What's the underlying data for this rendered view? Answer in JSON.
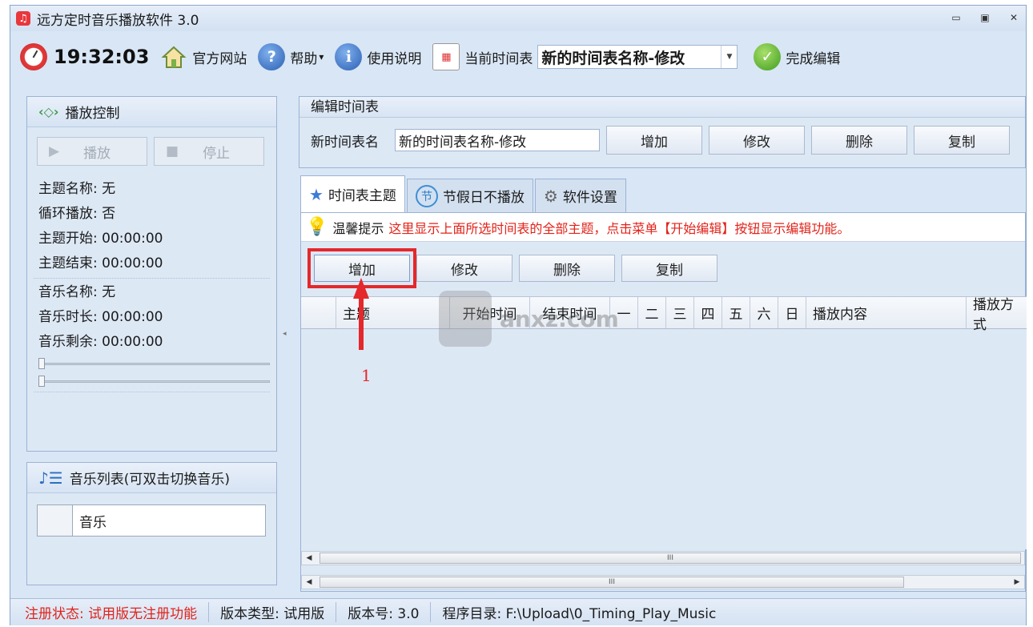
{
  "window": {
    "title": "远方定时音乐播放软件 3.0",
    "minimize": "▭",
    "restore": "▣",
    "close": "✕"
  },
  "toolbar": {
    "time": "19:32:03",
    "website": "官方网站",
    "help": "帮助",
    "help_arrow": "▾",
    "manual": "使用说明",
    "current_schedule_label": "当前时间表",
    "current_schedule_value": "新的时间表名称-修改",
    "finish_edit": "完成编辑"
  },
  "play_panel": {
    "title": "播放控制",
    "play": "播放",
    "stop": "停止",
    "theme_name": "主题名称: 无",
    "loop": "循环播放: 否",
    "theme_start": "主题开始: 00:00:00",
    "theme_end": "主题结束: 00:00:00",
    "music_name": "音乐名称: 无",
    "music_duration": "音乐时长: 00:00:00",
    "music_remaining": "音乐剩余: 00:00:00",
    "progress": 0,
    "volume": 0
  },
  "music_panel": {
    "title": "音乐列表(可双击切换音乐)",
    "column": "音乐"
  },
  "edit_schedule": {
    "title": "编辑时间表",
    "name_label": "新时间表名",
    "name_value": "新的时间表名称-修改",
    "add": "增加",
    "modify": "修改",
    "delete": "删除",
    "copy": "复制"
  },
  "tabs": [
    {
      "label": "时间表主题",
      "icon": "star-icon"
    },
    {
      "label": "节假日不播放",
      "icon": "festival-icon",
      "icon_text": "节"
    },
    {
      "label": "软件设置",
      "icon": "gear-icon"
    }
  ],
  "tip": {
    "label": "温馨提示",
    "message": "这里显示上面所选时间表的全部主题，点击菜单【开始编辑】按钮显示编辑功能。"
  },
  "theme_buttons": {
    "add": "增加",
    "modify": "修改",
    "delete": "删除",
    "copy": "复制"
  },
  "grid": {
    "columns": [
      "",
      "主题",
      "开始时间",
      "结束时间",
      "一",
      "二",
      "三",
      "四",
      "五",
      "六",
      "日",
      "播放内容",
      "播放方式"
    ]
  },
  "annotation": {
    "number": "1"
  },
  "watermark": {
    "text": "anxz.com"
  },
  "status": {
    "reg": "注册状态: 试用版无注册功能",
    "type": "版本类型: 试用版",
    "version": "版本号: 3.0",
    "dir": "程序目录: F:\\Upload\\0_Timing_Play_Music"
  },
  "colors": {
    "accent_red": "#e4282b",
    "tip_red": "#e2231a",
    "panel_bg": "#dde8f5"
  }
}
